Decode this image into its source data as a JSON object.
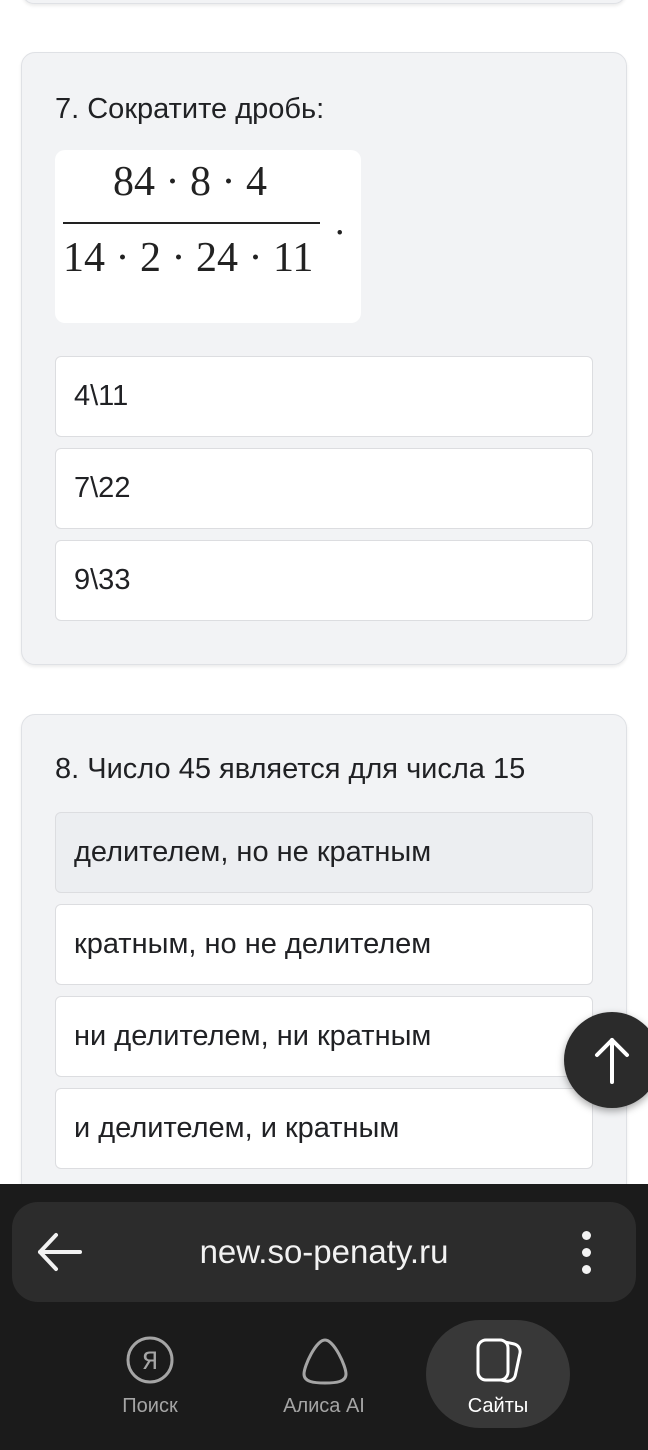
{
  "question7": {
    "title": "7. Сократите дробь:",
    "formula": {
      "numerator": "84 · 8 · 4",
      "denominator": "14 · 2 · 24 · 11",
      "trailing": "."
    },
    "options": [
      "4\\11",
      "7\\22",
      "9\\33"
    ]
  },
  "question8": {
    "title": "8. Число 45 является для числа 15",
    "options": [
      "делителем, но не кратным",
      "кратным, но не делителем",
      "ни делителем, ни кратным",
      "и делителем, и кратным"
    ],
    "selected_option": "делителем, но не кратным"
  },
  "scroll_top_button": {
    "icon": "arrow-up-icon"
  },
  "browser": {
    "url": "new.so-penaty.ru",
    "back_icon": "arrow-left-icon",
    "menu_icon": "more-vertical-icon",
    "tabs": [
      {
        "label": "Поиск",
        "icon": "yandex-search-icon"
      },
      {
        "label": "Алиса AI",
        "icon": "alice-icon"
      },
      {
        "label": "Сайты",
        "icon": "sites-icon",
        "active": true
      }
    ]
  },
  "colors": {
    "card_bg": "#f2f3f5",
    "bottom_bar_bg": "#1b1b1b",
    "url_bar_bg": "#2c2c2c",
    "active_tab_bg": "#383838"
  }
}
